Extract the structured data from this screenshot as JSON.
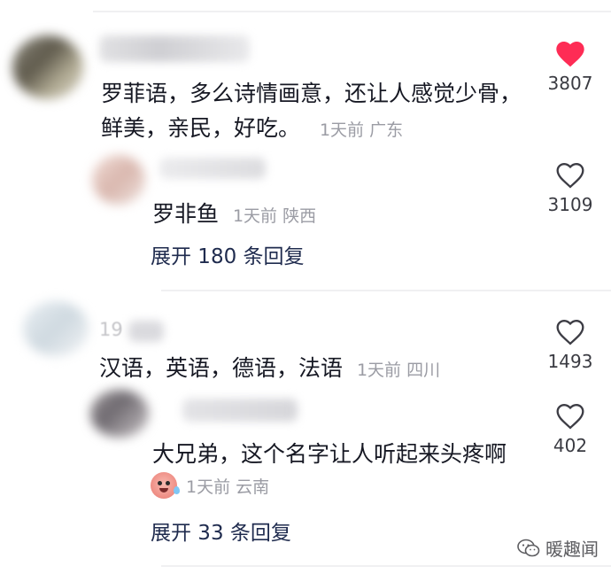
{
  "comments": [
    {
      "text_line1": "罗菲语，多么诗情画意，还让人感觉少骨，",
      "text_line2": "鲜美，亲民，好吃。",
      "meta": "1天前 广东",
      "likes": "3807",
      "liked": true,
      "reply": {
        "text": "罗非鱼",
        "meta": "1天前 陕西",
        "likes": "3109"
      },
      "expand_label": "展开 180 条回复"
    },
    {
      "username_partial": "19",
      "text": "汉语，英语，德语，法语",
      "meta": "1天前 四川",
      "likes": "1493",
      "reply": {
        "text": "大兄弟，这个名字让人听起来头疼啊",
        "meta": "1天前 云南",
        "likes": "402",
        "emoji": "sweat-emoji"
      },
      "expand_label": "展开 33 条回复"
    }
  ],
  "watermark": {
    "icon": "wechat-icon",
    "text": "暖趣闻"
  },
  "colors": {
    "liked_heart": "#fe2c55",
    "meta_gray": "#9b9ca4",
    "expand_text": "#1f2b4e"
  }
}
